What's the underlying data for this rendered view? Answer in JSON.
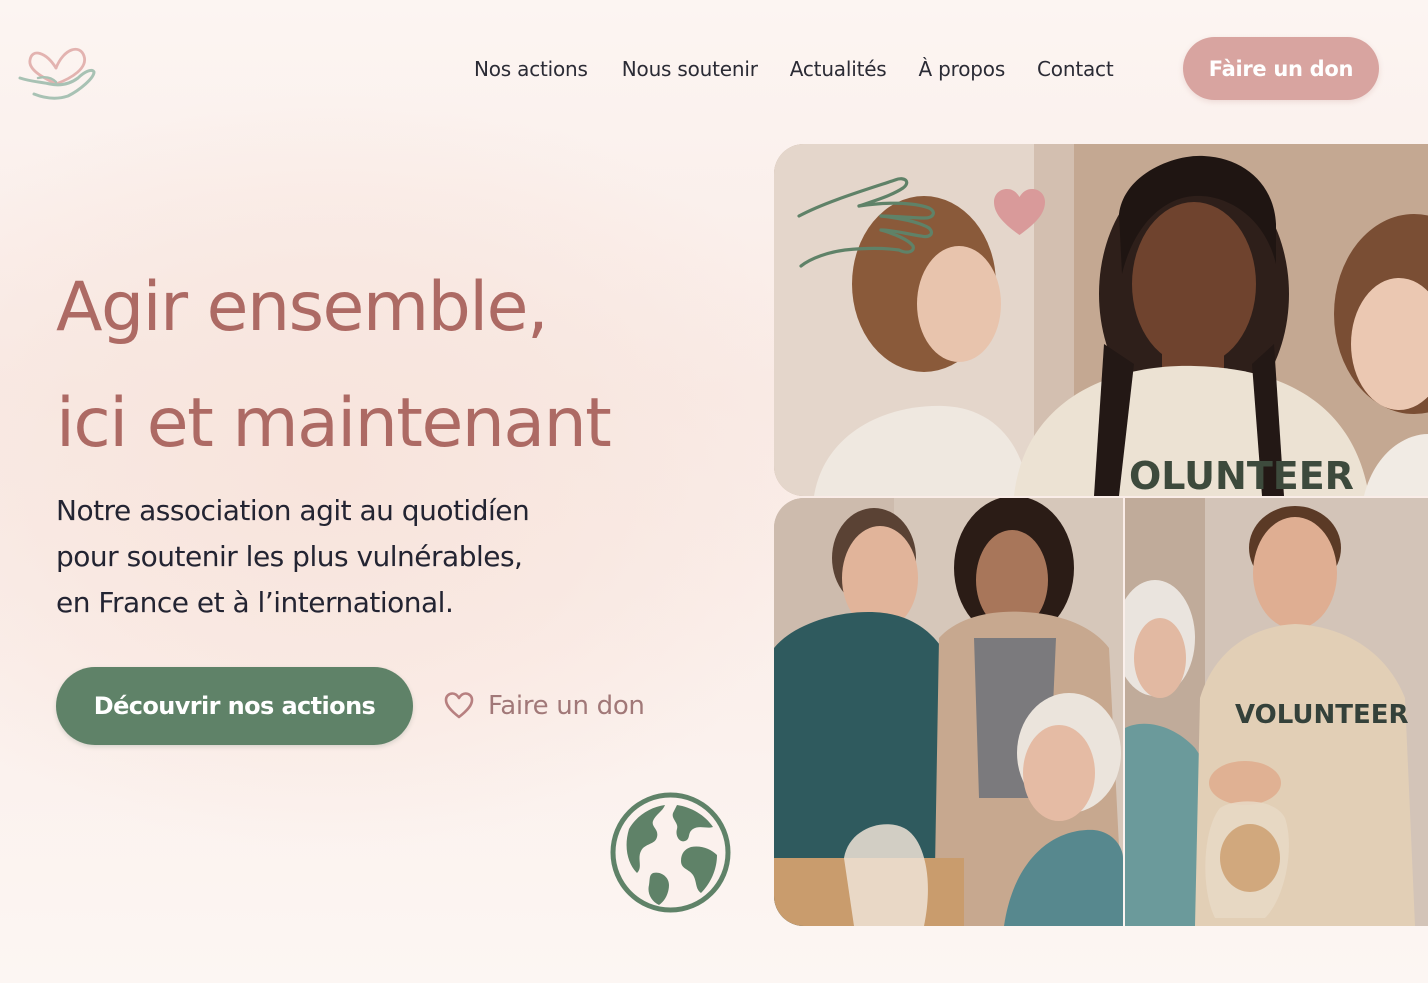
{
  "nav": {
    "items": [
      "Nos actions",
      "Nous soutenir",
      "Actualités",
      "À propos",
      "Contact"
    ],
    "cta_label": "Fàire un don"
  },
  "hero": {
    "title_line1": "Agir ensemble,",
    "title_line2": "ici et maintenant",
    "desc_line1": "Notre association agit au quotidíen",
    "desc_line2": "pour soutenir les plus vulnérables,",
    "desc_line3": "en France et à l’international.",
    "primary_label": "Découvrir nos actions",
    "secondary_label": "Faire un don"
  },
  "photos": {
    "shirt_text": "VOLUNTEER",
    "shirt_text_cropped": "OLUNTEER"
  },
  "icons": {
    "logo": "heart-hand-logo",
    "heart": "heart-outline-icon",
    "globe": "globe-icon",
    "hand_deco": "hand-doodle",
    "heart_deco": "heart-icon"
  },
  "colors": {
    "title": "#ad6a64",
    "primary_button": "#5f8268",
    "header_button": "#d8a4a0",
    "text_dark": "#232432",
    "secondary_link": "#a17878"
  }
}
